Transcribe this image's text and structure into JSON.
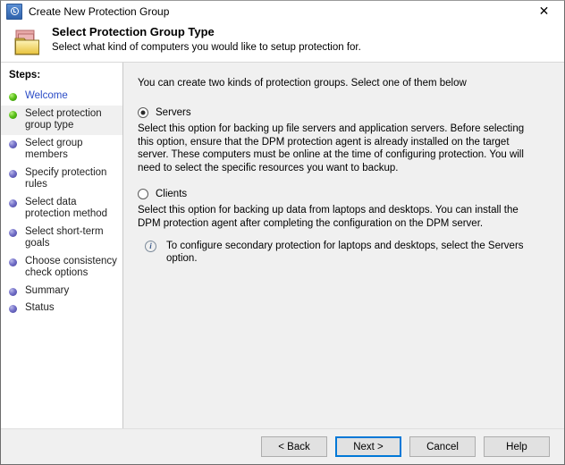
{
  "window": {
    "title": "Create New Protection Group",
    "title_icon": "dpm-shield-icon",
    "close_label": "✕"
  },
  "header": {
    "icon": "folder-icon",
    "title": "Select Protection Group Type",
    "subtitle": "Select what kind of computers you would like to setup protection for."
  },
  "sidebar": {
    "heading": "Steps:",
    "items": [
      {
        "label": "Welcome",
        "state": "done",
        "link": true,
        "current": false
      },
      {
        "label": "Select protection group type",
        "state": "done",
        "link": false,
        "current": true
      },
      {
        "label": "Select group members",
        "state": "todo",
        "link": false,
        "current": false
      },
      {
        "label": "Specify protection rules",
        "state": "todo",
        "link": false,
        "current": false
      },
      {
        "label": "Select data protection method",
        "state": "todo",
        "link": false,
        "current": false
      },
      {
        "label": "Select short-term goals",
        "state": "todo",
        "link": false,
        "current": false
      },
      {
        "label": "Choose consistency check options",
        "state": "todo",
        "link": false,
        "current": false
      },
      {
        "label": "Summary",
        "state": "todo",
        "link": false,
        "current": false
      },
      {
        "label": "Status",
        "state": "todo",
        "link": false,
        "current": false
      }
    ]
  },
  "main": {
    "intro": "You can create two kinds of protection groups. Select one of them below",
    "options": [
      {
        "label": "Servers",
        "selected": true,
        "description": "Select this option for backing up file servers and application servers. Before selecting this option, ensure that the DPM protection agent is already installed on the target server. These computers must be online at the time of configuring protection. You will need to select the specific resources you want to backup."
      },
      {
        "label": "Clients",
        "selected": false,
        "description": "Select this option for backing up data from laptops and desktops. You can install the DPM protection agent after completing the configuration on the DPM server."
      }
    ],
    "note": {
      "icon": "info-icon",
      "text": "To configure secondary protection for laptops and desktops, select the Servers option."
    }
  },
  "footer": {
    "buttons": [
      {
        "label": "< Back",
        "default": false
      },
      {
        "label": "Next >",
        "default": true
      },
      {
        "label": "Cancel",
        "default": false
      },
      {
        "label": "Help",
        "default": false
      }
    ]
  },
  "colors": {
    "accent": "#0078d7",
    "step_done": "#5bc21a",
    "step_todo": "#7471c9",
    "link": "#2b4cc6"
  }
}
